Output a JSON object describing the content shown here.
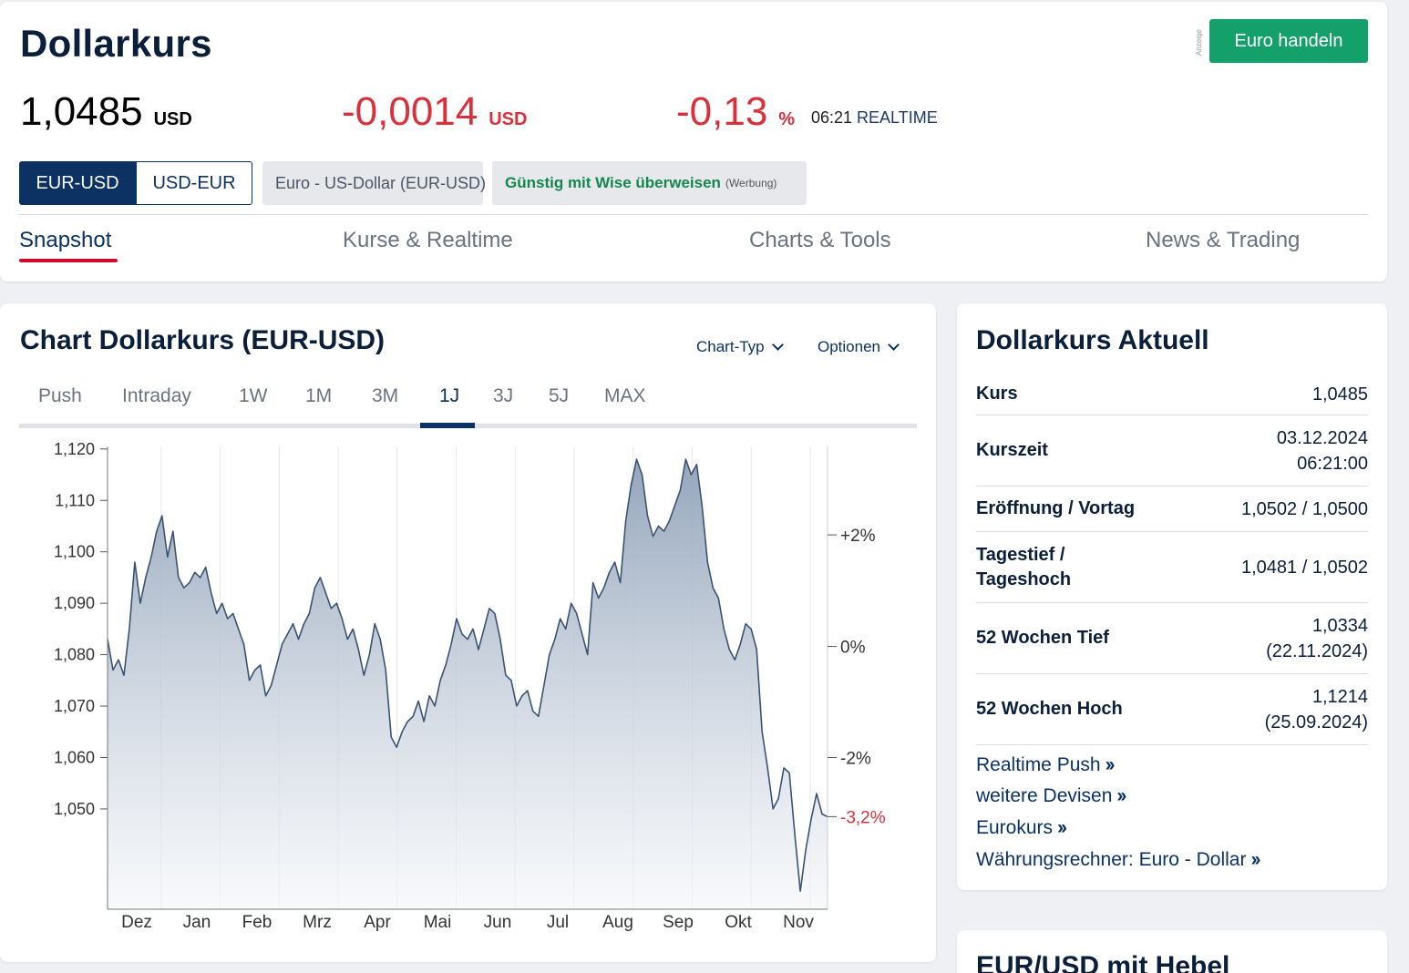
{
  "header": {
    "title": "Dollarkurs",
    "ad_label": "Anzeige",
    "trade_button": "Euro handeln",
    "price": "1,0485",
    "price_unit": "USD",
    "change": "-0,0014",
    "change_unit": "USD",
    "change_pct": "-0,13",
    "change_pct_unit": "%",
    "time": "06:21",
    "realtime_label": "REALTIME",
    "pair_options": [
      "EUR-USD",
      "USD-EUR"
    ],
    "pair_selected": "EUR-USD",
    "instrument_name": "Euro - US-Dollar (EUR-USD)",
    "wise_label": "Günstig mit Wise überweisen",
    "wise_ad": "(Werbung)",
    "tabs": [
      "Snapshot",
      "Kurse & Realtime",
      "Charts & Tools",
      "News & Trading"
    ],
    "active_tab": "Snapshot",
    "colors": {
      "negative": "#d9303c",
      "accent": "#0b3263",
      "trade_green": "#14a06a",
      "tab_underline": "#d00a2c"
    }
  },
  "chart_section": {
    "title": "Chart Dollarkurs (EUR-USD)",
    "chart_type_label": "Chart-Typ",
    "options_label": "Optionen",
    "ranges": [
      "Push",
      "Intraday",
      "1W",
      "1M",
      "3M",
      "1J",
      "3J",
      "5J",
      "MAX"
    ],
    "active_range": "1J"
  },
  "chart_data": {
    "type": "area",
    "series": [
      {
        "values": [
          1.083,
          1.077,
          1.079,
          1.076,
          1.085,
          1.098,
          1.09,
          1.095,
          1.099,
          1.104,
          1.107,
          1.099,
          1.104,
          1.095,
          1.093,
          1.094,
          1.096,
          1.095,
          1.097,
          1.092,
          1.088,
          1.09,
          1.087,
          1.088,
          1.085,
          1.082,
          1.075,
          1.077,
          1.078,
          1.072,
          1.074,
          1.078,
          1.082,
          1.084,
          1.086,
          1.083,
          1.086,
          1.088,
          1.093,
          1.095,
          1.092,
          1.089,
          1.09,
          1.087,
          1.083,
          1.085,
          1.081,
          1.076,
          1.08,
          1.086,
          1.083,
          1.077,
          1.064,
          1.062,
          1.065,
          1.067,
          1.068,
          1.071,
          1.067,
          1.072,
          1.07,
          1.075,
          1.078,
          1.082,
          1.087,
          1.084,
          1.083,
          1.085,
          1.081,
          1.085,
          1.089,
          1.088,
          1.083,
          1.076,
          1.075,
          1.07,
          1.072,
          1.073,
          1.069,
          1.068,
          1.074,
          1.08,
          1.083,
          1.087,
          1.085,
          1.09,
          1.088,
          1.084,
          1.08,
          1.094,
          1.091,
          1.093,
          1.096,
          1.098,
          1.094,
          1.106,
          1.113,
          1.118,
          1.115,
          1.107,
          1.103,
          1.105,
          1.104,
          1.106,
          1.109,
          1.112,
          1.118,
          1.115,
          1.117,
          1.109,
          1.098,
          1.093,
          1.091,
          1.085,
          1.081,
          1.079,
          1.082,
          1.086,
          1.085,
          1.081,
          1.065,
          1.058,
          1.05,
          1.052,
          1.058,
          1.057,
          1.045,
          1.034,
          1.042,
          1.048,
          1.053,
          1.049,
          1.0485
        ]
      }
    ],
    "x_labels": [
      "Dez",
      "Jan",
      "Feb",
      "Mrz",
      "Apr",
      "Mai",
      "Jun",
      "Jul",
      "Aug",
      "Sep",
      "Okt",
      "Nov"
    ],
    "y_ticks": [
      "1,120",
      "1,110",
      "1,100",
      "1,090",
      "1,080",
      "1,070",
      "1,060",
      "1,050"
    ],
    "y_range": [
      1.0305,
      1.1205
    ],
    "secondary_ticks": [
      {
        "label": "+2%",
        "value": 1.1033
      },
      {
        "label": "0%",
        "value": 1.0816
      },
      {
        "label": "-2%",
        "value": 1.06
      }
    ],
    "current_marker": {
      "label": "-3,2%",
      "value": 1.0485,
      "color": "#d9303c"
    },
    "line_color": "#3a5374",
    "fill_top_color": "#8fa1b8",
    "grid": true
  },
  "side": {
    "title": "Dollarkurs Aktuell",
    "rows": [
      {
        "label": "Kurs",
        "value": "1,0485",
        "value2": ""
      },
      {
        "label": "Kurszeit",
        "value": "03.12.2024",
        "value2": "06:21:00"
      },
      {
        "label": "Eröffnung / Vortag",
        "value": "1,0502 / 1,0500",
        "value2": ""
      },
      {
        "label": "Tagestief / Tageshoch",
        "value": "1,0481 / 1,0502",
        "value2": ""
      },
      {
        "label": "52 Wochen Tief",
        "value": "1,0334",
        "value2": "(22.11.2024)"
      },
      {
        "label": "52 Wochen Hoch",
        "value": "1,1214",
        "value2": "(25.09.2024)"
      }
    ],
    "links": [
      "Realtime Push",
      "weitere Devisen",
      "Eurokurs",
      "Währungsrechner: Euro - Dollar"
    ]
  },
  "hebel_card": {
    "title": "EUR/USD mit Hebel"
  }
}
